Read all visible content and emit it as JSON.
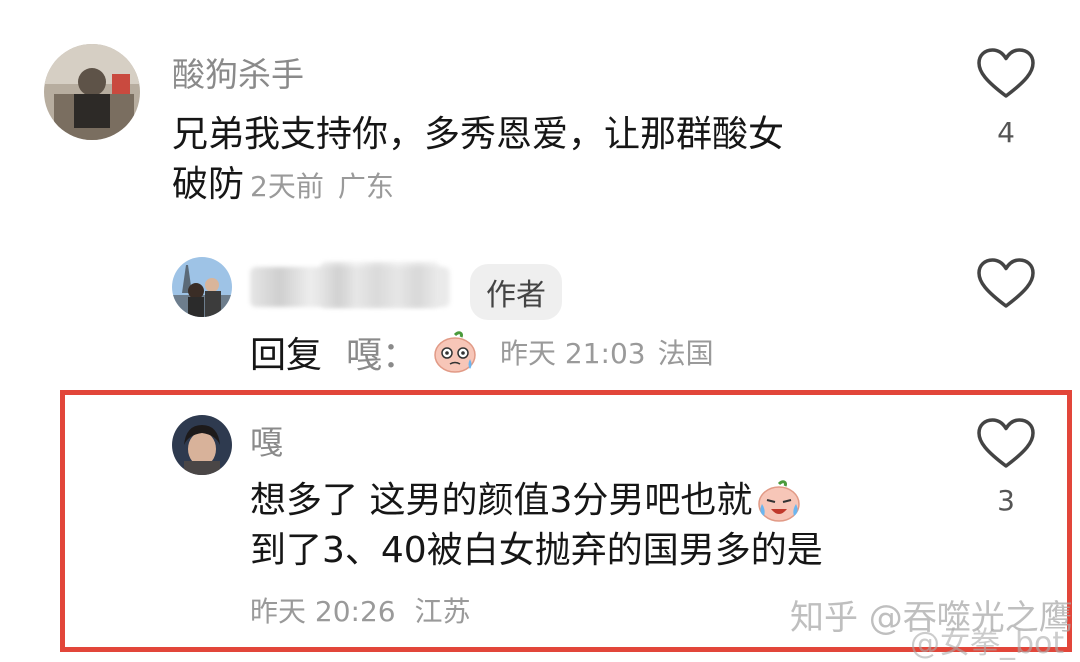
{
  "comments": [
    {
      "username": "酸狗杀手",
      "text_line1": "兄弟我支持你，多秀恩爱，让那群酸女",
      "text_line2": "破防",
      "time": "2天前",
      "location": "广东",
      "likes": "4"
    },
    {
      "author_badge": "作者",
      "reply_prefix": "回复",
      "reply_to": "嘎：",
      "time": "昨天 21:03",
      "location": "法国"
    },
    {
      "username": "嘎",
      "text_line1": "想多了 这男的颜值3分男吧也就",
      "text_line2": "到了3、40被白女抛弃的国男多的是",
      "time": "昨天 20:26",
      "location": "江苏",
      "likes": "3"
    }
  ],
  "watermark": {
    "line1": "知乎 @吞噬光之鹰",
    "line2": "@女拳_bot"
  },
  "colors": {
    "highlight_border": "#e2463a",
    "username_gray": "#8a8a8a",
    "meta_gray": "#9a9a9a"
  }
}
